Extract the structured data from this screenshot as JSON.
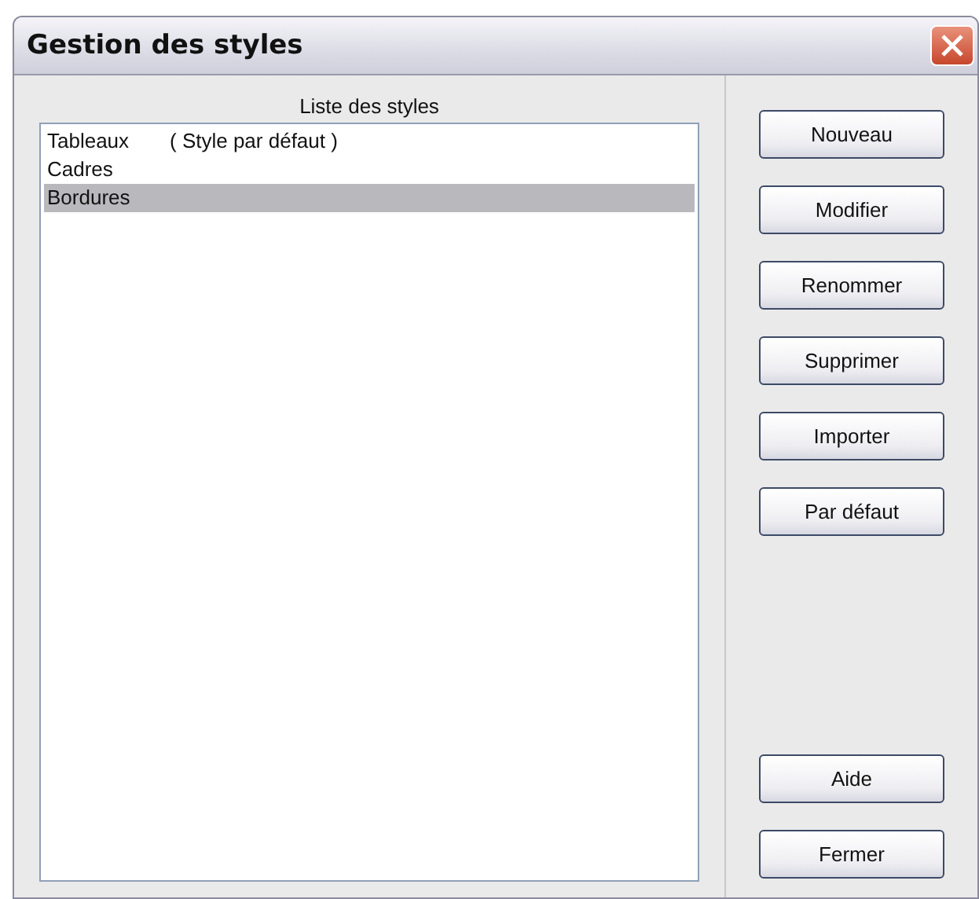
{
  "window": {
    "title": "Gestion des styles"
  },
  "list": {
    "label": "Liste des styles",
    "items": [
      {
        "name": "Tableaux",
        "note": "( Style par défaut )",
        "selected": false
      },
      {
        "name": "Cadres",
        "selected": false
      },
      {
        "name": "Bordures",
        "selected": true
      }
    ]
  },
  "buttons": {
    "top": [
      "Nouveau",
      "Modifier",
      "Renommer",
      "Supprimer",
      "Importer",
      "Par défaut"
    ],
    "bottom": [
      "Aide",
      "Fermer"
    ]
  }
}
